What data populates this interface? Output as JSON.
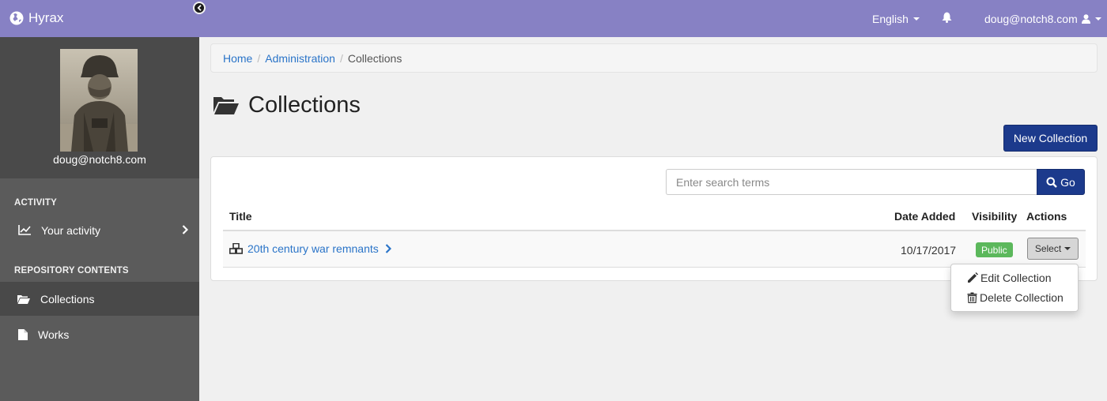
{
  "navbar": {
    "brand": "Hyrax",
    "language": "English",
    "user": "doug@notch8.com"
  },
  "sidebar": {
    "profile_name": "doug@notch8.com",
    "sections": [
      {
        "title": "ACTIVITY",
        "items": [
          {
            "label": "Your activity"
          }
        ]
      },
      {
        "title": "REPOSITORY CONTENTS",
        "items": [
          {
            "label": "Collections",
            "active": true
          },
          {
            "label": "Works"
          }
        ]
      }
    ]
  },
  "breadcrumb": [
    {
      "label": "Home"
    },
    {
      "label": "Administration"
    },
    {
      "label": "Collections"
    }
  ],
  "page": {
    "title": "Collections",
    "new_button": "New Collection"
  },
  "search": {
    "placeholder": "Enter search terms",
    "button": "Go"
  },
  "table": {
    "columns": [
      "Title",
      "Date Added",
      "Visibility",
      "Actions"
    ],
    "rows": [
      {
        "title": "20th century war remnants",
        "date_added": "10/17/2017",
        "visibility": "Public",
        "action": "Select"
      }
    ]
  },
  "actions_menu": [
    "Edit Collection",
    "Delete Collection"
  ],
  "colors": {
    "navbar": "#8781c4",
    "primary_button": "#1c3a8c",
    "link": "#2a74c8",
    "public_badge": "#5cb85c",
    "sidebar": "#5b5b5b"
  }
}
